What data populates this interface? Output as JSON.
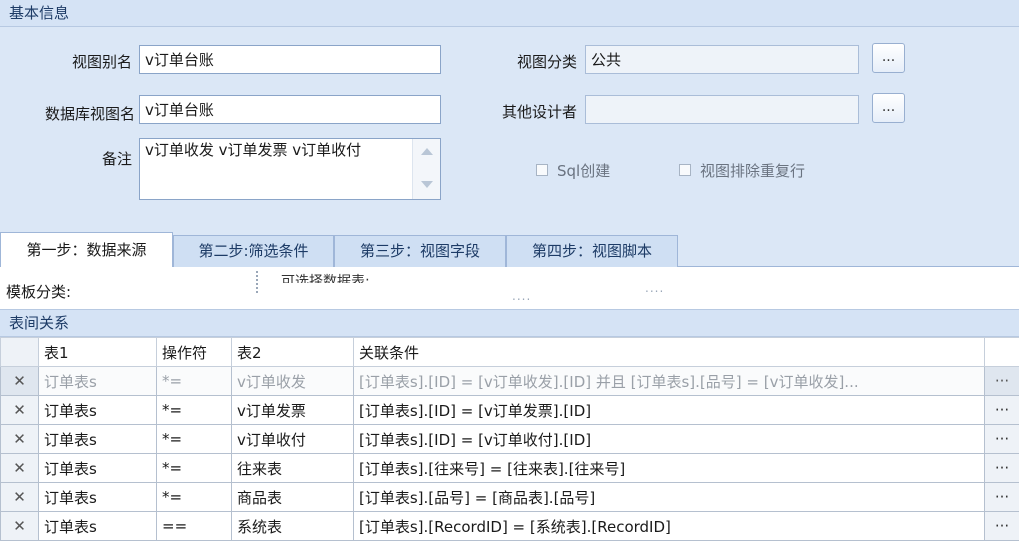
{
  "basic": {
    "header": "基本信息",
    "view_alias_label": "视图别名",
    "view_alias_value": "v订单台账",
    "db_view_name_label": "数据库视图名",
    "db_view_name_value": "v订单台账",
    "remarks_label": "备注",
    "remarks_value": "v订单收发 v订单发票 v订单收付",
    "view_category_label": "视图分类",
    "view_category_value": "公共",
    "other_designers_label": "其他设计者",
    "other_designers_value": "",
    "browse_label": "...",
    "sql_create_label": "Sql创建",
    "dedupe_label": "视图排除重复行"
  },
  "tabs": [
    {
      "label": "第一步：数据来源",
      "active": true
    },
    {
      "label": "第二步:筛选条件",
      "active": false
    },
    {
      "label": "第三步：视图字段",
      "active": false
    },
    {
      "label": "第四步：视图脚本",
      "active": false
    }
  ],
  "datasource": {
    "template_category_label": "模板分类:",
    "selectable_tables_label": "可选择数据表:",
    "dots": "....",
    "relations_header": "表间关系"
  },
  "grid": {
    "columns": [
      "表1",
      "操作符",
      "表2",
      "关联条件"
    ],
    "delete_glyph": "✕",
    "more_glyph": "···",
    "rows": [
      {
        "t1": "订单表s",
        "op": "*=",
        "t2": "v订单收发",
        "cond": "[订单表s].[ID] = [v订单收发].[ID] 并且 [订单表s].[品号] = [v订单收发]...",
        "selected": true
      },
      {
        "t1": "订单表s",
        "op": "*=",
        "t2": "v订单发票",
        "cond": "[订单表s].[ID] = [v订单发票].[ID]",
        "selected": false
      },
      {
        "t1": "订单表s",
        "op": "*=",
        "t2": "v订单收付",
        "cond": "[订单表s].[ID] = [v订单收付].[ID]",
        "selected": false
      },
      {
        "t1": "订单表s",
        "op": "*=",
        "t2": "往来表",
        "cond": "[订单表s].[往来号] = [往来表].[往来号]",
        "selected": false
      },
      {
        "t1": "订单表s",
        "op": "*=",
        "t2": "商品表",
        "cond": "[订单表s].[品号] = [商品表].[品号]",
        "selected": false
      },
      {
        "t1": "订单表s",
        "op": "==",
        "t2": "系统表",
        "cond": "[订单表s].[RecordID] = [系统表].[RecordID]",
        "selected": false
      }
    ]
  },
  "colors": {
    "panel_bg": "#dbe7f6",
    "header_bg": "#d5e3f5",
    "accent": "#1d3b66"
  }
}
